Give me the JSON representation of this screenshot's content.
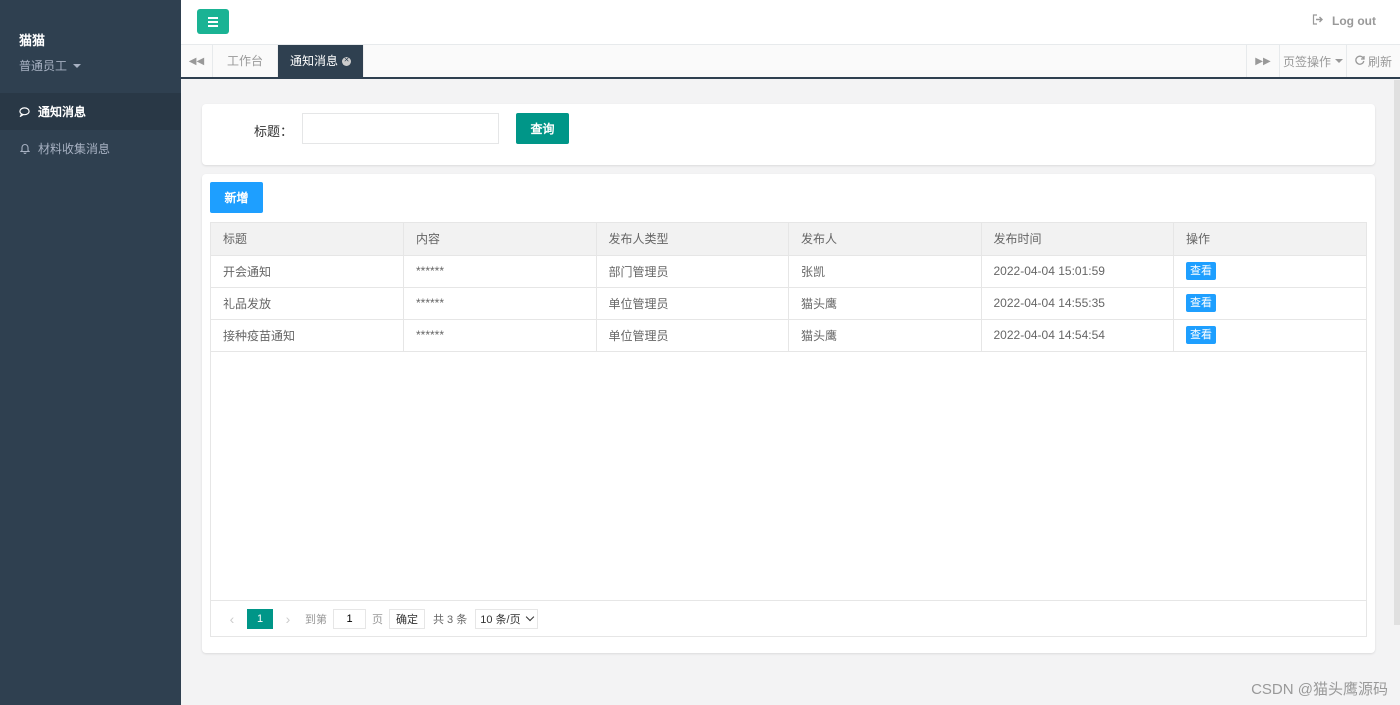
{
  "sidebar": {
    "user_name": "猫猫",
    "user_role": "普通员工",
    "items": [
      {
        "label": "通知消息",
        "icon": "comment-icon",
        "active": true
      },
      {
        "label": "材料收集消息",
        "icon": "bell-icon",
        "active": false
      }
    ]
  },
  "topbar": {
    "logout_label": "Log out"
  },
  "tabs": {
    "items": [
      "工作台",
      "通知消息"
    ],
    "page_ops_label": "页签操作",
    "refresh_label": "刷新"
  },
  "search": {
    "label": "标题：",
    "value": "",
    "button_label": "查询"
  },
  "table": {
    "add_label": "新增",
    "columns": [
      "标题",
      "内容",
      "发布人类型",
      "发布人",
      "发布时间",
      "操作"
    ],
    "view_label": "查看",
    "rows": [
      [
        "开会通知",
        "******",
        "部门管理员",
        "张凯",
        "2022-04-04 15:01:59"
      ],
      [
        "礼品发放",
        "******",
        "单位管理员",
        "猫头鹰",
        "2022-04-04 14:55:35"
      ],
      [
        "接种疫苗通知",
        "******",
        "单位管理员",
        "猫头鹰",
        "2022-04-04 14:54:54"
      ]
    ]
  },
  "pager": {
    "current": "1",
    "goto_prefix": "到第",
    "goto_value": "1",
    "goto_suffix": "页",
    "confirm_label": "确定",
    "total_label": "共 3 条",
    "page_size_label": "10 条/页"
  },
  "watermark": "CSDN @猫头鹰源码",
  "colors": {
    "sidebar": "#2f4050",
    "accent": "#009688",
    "primary": "#1e9fff",
    "menu": "#1ab394"
  }
}
